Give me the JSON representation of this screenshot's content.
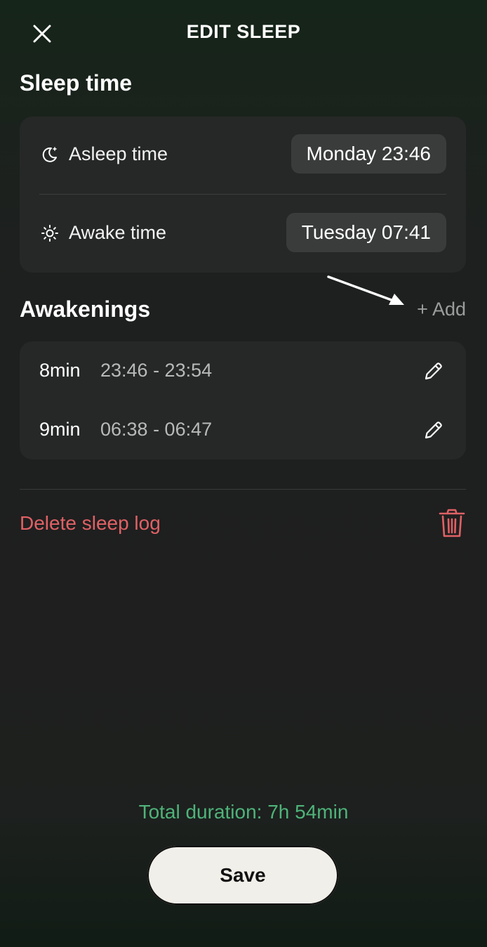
{
  "header": {
    "title": "EDIT SLEEP"
  },
  "sleep_time": {
    "title": "Sleep time",
    "asleep": {
      "label": "Asleep time",
      "value": "Monday 23:46",
      "icon": "moon-icon"
    },
    "awake": {
      "label": "Awake time",
      "value": "Tuesday 07:41",
      "icon": "sun-icon"
    }
  },
  "awakenings": {
    "title": "Awakenings",
    "add_label": "+ Add",
    "items": [
      {
        "duration": "8min",
        "range": "23:46 - 23:54"
      },
      {
        "duration": "9min",
        "range": "06:38 - 06:47"
      }
    ]
  },
  "delete": {
    "label": "Delete sleep log"
  },
  "footer": {
    "total": "Total duration: 7h 54min",
    "save_label": "Save"
  },
  "colors": {
    "accent_green": "#4fb37a",
    "danger_red": "#e06165",
    "card": "#262827"
  }
}
